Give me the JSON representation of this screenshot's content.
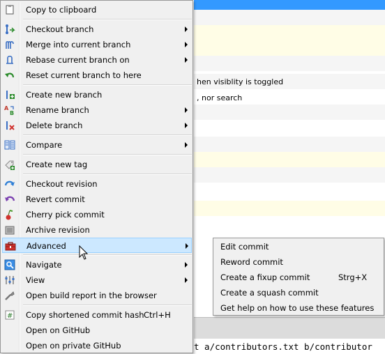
{
  "background": {
    "line_1": "hen visiblity is toggled",
    "line_2": ", nor search",
    "diff_line": "t a/contributors.txt b/contributor"
  },
  "colors": {
    "selection_blue": "#3399ff",
    "highlight": "#cce8ff",
    "row_yellow": "#fffde6"
  },
  "menu": {
    "items": [
      {
        "label": "Copy to clipboard",
        "icon": "clipboard-icon"
      },
      {
        "label": "Checkout branch",
        "icon": "checkout-branch-icon"
      },
      {
        "label": "Merge into current branch",
        "icon": "merge-icon"
      },
      {
        "label": "Rebase current branch on",
        "icon": "rebase-icon"
      },
      {
        "label": "Reset current branch to here",
        "icon": "reset-icon"
      },
      {
        "label": "Create new branch",
        "icon": "create-branch-icon"
      },
      {
        "label": "Rename branch",
        "icon": "rename-branch-icon"
      },
      {
        "label": "Delete branch",
        "icon": "delete-branch-icon"
      },
      {
        "label": "Compare",
        "icon": "compare-icon"
      },
      {
        "label": "Create new tag",
        "icon": "tag-icon"
      },
      {
        "label": "Checkout revision",
        "icon": "checkout-revision-icon"
      },
      {
        "label": "Revert commit",
        "icon": "revert-icon"
      },
      {
        "label": "Cherry pick commit",
        "icon": "cherry-icon"
      },
      {
        "label": "Archive revision",
        "icon": "archive-icon"
      },
      {
        "label": "Advanced",
        "icon": "toolbox-icon"
      },
      {
        "label": "Navigate",
        "icon": "navigate-icon"
      },
      {
        "label": "View",
        "icon": "view-icon"
      },
      {
        "label": "Open build report in the browser",
        "icon": "build-report-icon"
      },
      {
        "label": "Copy shortened commit hash",
        "icon": "hash-icon",
        "shortcut": "Ctrl+H"
      },
      {
        "label": "Open on GitHub",
        "icon": ""
      },
      {
        "label": "Open on private GitHub",
        "icon": ""
      }
    ]
  },
  "submenu": {
    "items": [
      {
        "label": "Edit commit"
      },
      {
        "label": "Reword commit"
      },
      {
        "label": "Create a fixup commit",
        "shortcut": "Strg+X"
      },
      {
        "label": "Create a squash commit"
      },
      {
        "label": "Get help on how to use these features"
      }
    ]
  }
}
